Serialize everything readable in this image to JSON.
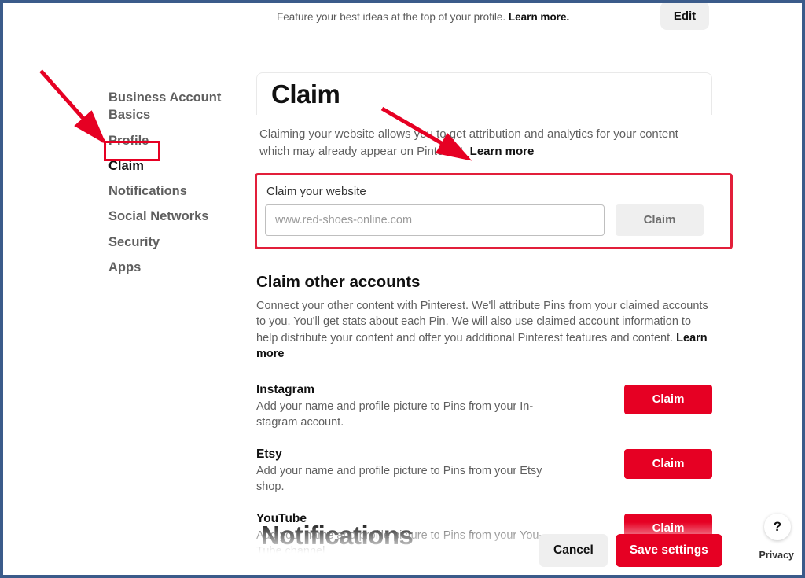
{
  "top": {
    "featured_desc_prefix": "Feature your best ideas at the top of your profile. ",
    "featured_learn_more": "Learn more.",
    "edit_label": "Edit"
  },
  "sidebar": {
    "items": [
      {
        "label": "Business Account Basics"
      },
      {
        "label": "Profile"
      },
      {
        "label": "Claim"
      },
      {
        "label": "Notifications"
      },
      {
        "label": "Social Networks"
      },
      {
        "label": "Security"
      },
      {
        "label": "Apps"
      }
    ]
  },
  "claim_section": {
    "heading": "Claim",
    "desc_prefix": "Claiming your website allows you to get attribution and analytics for your content which may already appear on Pinterest. ",
    "learn_more": "Learn more",
    "website_label": "Claim your website",
    "website_placeholder": "www.red-shoes-online.com",
    "website_claim_btn": "Claim"
  },
  "other_accounts": {
    "heading": "Claim other accounts",
    "desc_prefix": "Connect your other content with Pinterest. We'll attribute Pins from your claimed accounts to you. You'll get stats about each Pin. We will also use claimed account information to help dis­tribute your content and offer you additional Pinterest features and content. ",
    "learn_more": "Learn more",
    "accounts": [
      {
        "name": "Instagram",
        "desc": "Add your name and profile picture to Pins from your In­stagram account.",
        "btn": "Claim"
      },
      {
        "name": "Etsy",
        "desc": "Add your name and profile picture to Pins from your Etsy shop.",
        "btn": "Claim"
      },
      {
        "name": "YouTube",
        "desc": "Add your name and profile picture to Pins from your You­Tube channel.",
        "btn": "Claim"
      }
    ]
  },
  "next_section_heading": "Notifications",
  "footer": {
    "cancel": "Cancel",
    "save": "Save settings"
  },
  "corner": {
    "help": "?",
    "privacy": "Privacy"
  }
}
